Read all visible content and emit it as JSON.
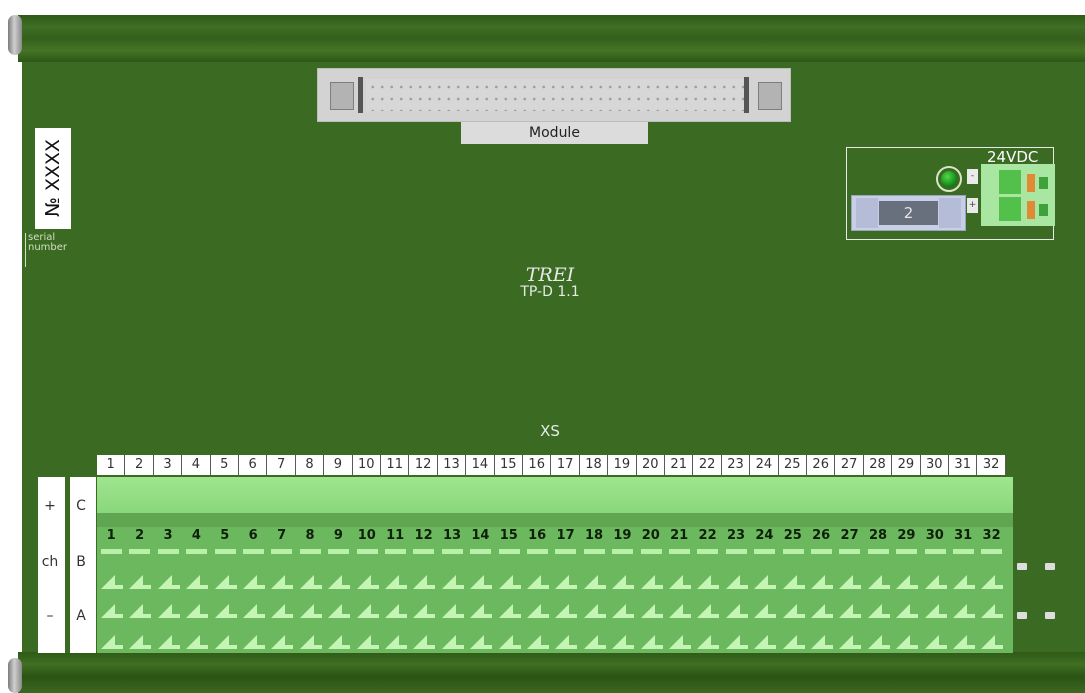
{
  "connector": {
    "label": "Module"
  },
  "power": {
    "voltage_label": "24VDC",
    "minus_label": "-",
    "plus_label": "+",
    "fuse_label": "2",
    "led_color": "#1aa02a"
  },
  "serial": {
    "text": "№ XXXX",
    "sub1": "serial",
    "sub2": "number"
  },
  "brand": {
    "name": "TREI",
    "model": "TP-D 1.1"
  },
  "terminal": {
    "header": "XS",
    "numbers": [
      "1",
      "2",
      "3",
      "4",
      "5",
      "6",
      "7",
      "8",
      "9",
      "10",
      "11",
      "12",
      "13",
      "14",
      "15",
      "16",
      "17",
      "18",
      "19",
      "20",
      "21",
      "22",
      "23",
      "24",
      "25",
      "26",
      "27",
      "28",
      "29",
      "30",
      "31",
      "32"
    ],
    "side_left": [
      "+",
      "ch",
      "–"
    ],
    "side_right": [
      "C",
      "B",
      "A"
    ]
  },
  "colors": {
    "board": "#3b6a23",
    "rail": "#2e5a17",
    "terminal": "#8ad77b"
  }
}
